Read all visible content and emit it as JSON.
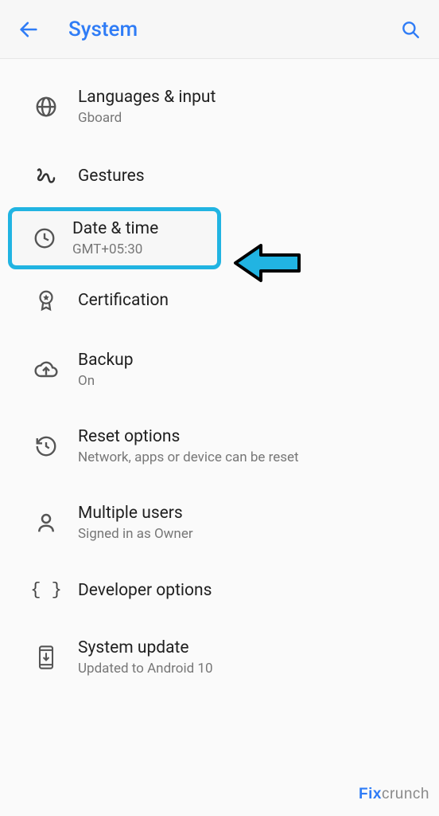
{
  "header": {
    "title": "System"
  },
  "items": [
    {
      "title": "Languages & input",
      "sub": "Gboard"
    },
    {
      "title": "Gestures",
      "sub": ""
    },
    {
      "title": "Date & time",
      "sub": "GMT+05:30"
    },
    {
      "title": "Certification",
      "sub": ""
    },
    {
      "title": "Backup",
      "sub": "On"
    },
    {
      "title": "Reset options",
      "sub": "Network, apps or device can be reset"
    },
    {
      "title": "Multiple users",
      "sub": "Signed in as Owner"
    },
    {
      "title": "Developer options",
      "sub": ""
    },
    {
      "title": "System update",
      "sub": "Updated to Android 10"
    }
  ],
  "watermark": {
    "left": "Fix",
    "right": "crunch"
  }
}
